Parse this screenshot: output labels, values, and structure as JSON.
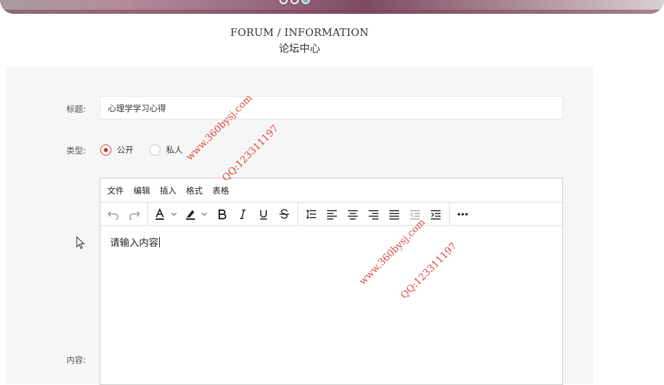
{
  "header": {
    "title_en": "FORUM / INFORMATION",
    "title_cn": "论坛中心"
  },
  "form": {
    "title_label": "标题:",
    "title_value": "心理学学习心得",
    "type_label": "类型:",
    "type_options": [
      {
        "label": "公开",
        "checked": true
      },
      {
        "label": "私人",
        "checked": false
      }
    ],
    "content_label": "内容:"
  },
  "editor": {
    "menu": [
      "文件",
      "编辑",
      "插入",
      "格式",
      "表格"
    ],
    "placeholder": "请输入内容"
  },
  "watermarks": [
    "www.360bysj.com",
    "QQ:123311197",
    "www.360bysj.com",
    "QQ:123311197"
  ],
  "colors": {
    "accent": "#c73b35",
    "watermark": "#e23b3b",
    "panel_bg": "#f6f6f6"
  }
}
